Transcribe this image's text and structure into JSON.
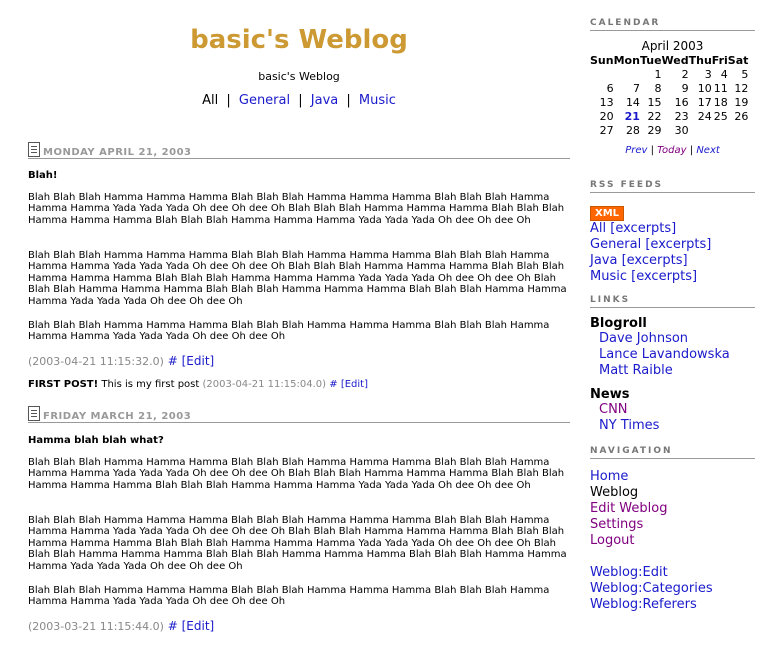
{
  "header": {
    "title": "basic's Weblog",
    "description": "basic's Weblog",
    "categories": [
      {
        "label": "All"
      },
      {
        "label": "General"
      },
      {
        "label": "Java"
      },
      {
        "label": "Music"
      }
    ],
    "separator": "|"
  },
  "days": [
    {
      "date": "MONDAY APRIL 21, 2003",
      "entries": [
        {
          "title": "Blah!",
          "paragraphs": [
            "Blah Blah Blah Hamma Hamma Hamma Blah Blah Blah Hamma Hamma Hamma Blah Blah Blah Hamma Hamma Hamma Yada Yada Yada Oh dee Oh dee Oh Blah Blah Blah Hamma Hamma Hamma Blah Blah Blah Hamma Hamma Hamma Blah Blah Blah Hamma Hamma Hamma Yada Yada Yada Oh dee Oh dee Oh",
            "Blah Blah Blah Hamma Hamma Hamma Blah Blah Blah Hamma Hamma Hamma Blah Blah Blah Hamma Hamma Hamma Yada Yada Yada Oh dee Oh dee Oh Blah Blah Blah Hamma Hamma Hamma Blah Blah Blah Hamma Hamma Hamma Blah Blah Blah Hamma Hamma Hamma Yada Yada Yada Oh dee Oh dee Oh Blah Blah Blah Hamma Hamma Hamma Blah Blah Blah Hamma Hamma Hamma Blah Blah Blah Hamma Hamma Hamma Yada Yada Yada Oh dee Oh dee Oh",
            "Blah Blah Blah Hamma Hamma Hamma Blah Blah Blah Hamma Hamma Hamma Blah Blah Blah Hamma Hamma Hamma Yada Yada Yada Oh dee Oh dee Oh"
          ],
          "timestamp": "(2003-04-21 11:15:32.0)",
          "permalink": "#",
          "edit": "[Edit]"
        },
        {
          "title": "FIRST POST!",
          "text": "This is my first post",
          "timestamp": "(2003-04-21 11:15:04.0)",
          "permalink": "#",
          "edit": "[Edit]"
        }
      ]
    },
    {
      "date": "FRIDAY MARCH 21, 2003",
      "entries": [
        {
          "title": "Hamma blah blah what?",
          "paragraphs": [
            "Blah Blah Blah Hamma Hamma Hamma Blah Blah Blah Hamma Hamma Hamma Blah Blah Blah Hamma Hamma Hamma Yada Yada Yada Oh dee Oh dee Oh Blah Blah Blah Hamma Hamma Hamma Blah Blah Blah Hamma Hamma Hamma Blah Blah Blah Hamma Hamma Hamma Yada Yada Yada Oh dee Oh dee Oh",
            "Blah Blah Blah Hamma Hamma Hamma Blah Blah Blah Hamma Hamma Hamma Blah Blah Blah Hamma Hamma Hamma Yada Yada Yada Oh dee Oh dee Oh Blah Blah Blah Hamma Hamma Hamma Blah Blah Blah Hamma Hamma Hamma Blah Blah Blah Hamma Hamma Hamma Yada Yada Yada Oh dee Oh dee Oh Blah Blah Blah Hamma Hamma Hamma Blah Blah Blah Hamma Hamma Hamma Blah Blah Blah Hamma Hamma Hamma Yada Yada Yada Oh dee Oh dee Oh",
            "Blah Blah Blah Hamma Hamma Hamma Blah Blah Blah Hamma Hamma Hamma Blah Blah Blah Hamma Hamma Hamma Yada Yada Yada Oh dee Oh dee Oh"
          ],
          "timestamp": "(2003-03-21 11:15:44.0)",
          "permalink": "#",
          "edit": "[Edit]"
        }
      ]
    }
  ],
  "sidebar": {
    "calendar": {
      "heading": "CALENDAR",
      "month": "April 2003",
      "weekdays": [
        "Sun",
        "Mon",
        "Tue",
        "Wed",
        "Thu",
        "Fri",
        "Sat"
      ],
      "weeks": [
        [
          "",
          "",
          "1",
          "2",
          "3",
          "4",
          "5"
        ],
        [
          "6",
          "7",
          "8",
          "9",
          "10",
          "11",
          "12"
        ],
        [
          "13",
          "14",
          "15",
          "16",
          "17",
          "18",
          "19"
        ],
        [
          "20",
          "21",
          "22",
          "23",
          "24",
          "25",
          "26"
        ],
        [
          "27",
          "28",
          "29",
          "30",
          "",
          "",
          ""
        ]
      ],
      "today": "21",
      "prev": "Prev",
      "today_label": "Today",
      "next": "Next",
      "sep": "|"
    },
    "rss": {
      "heading": "RSS FEEDS",
      "badge": "XML",
      "feeds": [
        "All [excerpts]",
        "General [excerpts]",
        "Java [excerpts]",
        "Music [excerpts]"
      ]
    },
    "links": {
      "heading": "LINKS",
      "blogroll_title": "Blogroll",
      "blogroll": [
        "Dave Johnson",
        "Lance Lavandowska",
        "Matt Raible"
      ],
      "news_title": "News",
      "news": [
        "CNN",
        "NY Times"
      ]
    },
    "navigation": {
      "heading": "NAVIGATION",
      "items": [
        "Home",
        "Weblog",
        "Edit Weblog",
        "Settings",
        "Logout"
      ],
      "weblog_links": [
        "Weblog:Edit",
        "Weblog:Categories",
        "Weblog:Referers"
      ]
    }
  }
}
